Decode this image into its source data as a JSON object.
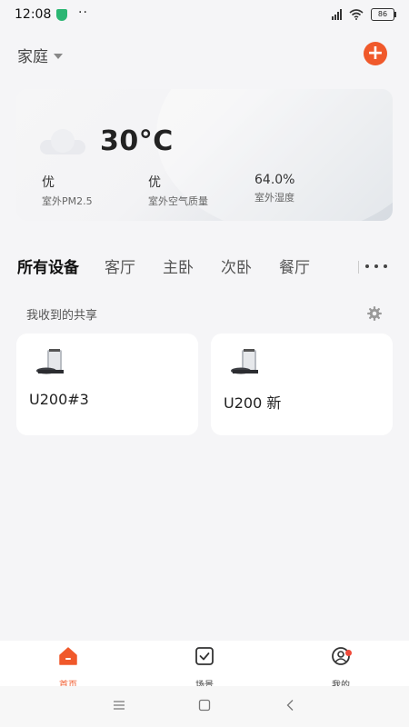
{
  "status_bar": {
    "time": "12:08",
    "dots": "··",
    "battery": "86"
  },
  "header": {
    "home_label": "家庭",
    "add_symbol": "+"
  },
  "weather": {
    "temperature": "30°C",
    "metrics": [
      {
        "value": "优",
        "label": "室外PM2.5"
      },
      {
        "value": "优",
        "label": "室外空气质量"
      },
      {
        "value": "64.0%",
        "label": "室外湿度"
      }
    ]
  },
  "tabs": [
    "所有设备",
    "客厅",
    "主卧",
    "次卧",
    "餐厅"
  ],
  "shared": {
    "title": "我收到的共享",
    "devices": [
      {
        "name": "U200#3"
      },
      {
        "name": "U200 新"
      }
    ]
  },
  "bottom_nav": [
    {
      "label": "首页",
      "icon": "home-icon",
      "active": true
    },
    {
      "label": "场景",
      "icon": "scene-icon",
      "active": false
    },
    {
      "label": "我的",
      "icon": "profile-icon",
      "active": false
    }
  ],
  "colors": {
    "accent": "#f0592b",
    "background": "#f5f5f7",
    "card": "#ffffff"
  }
}
